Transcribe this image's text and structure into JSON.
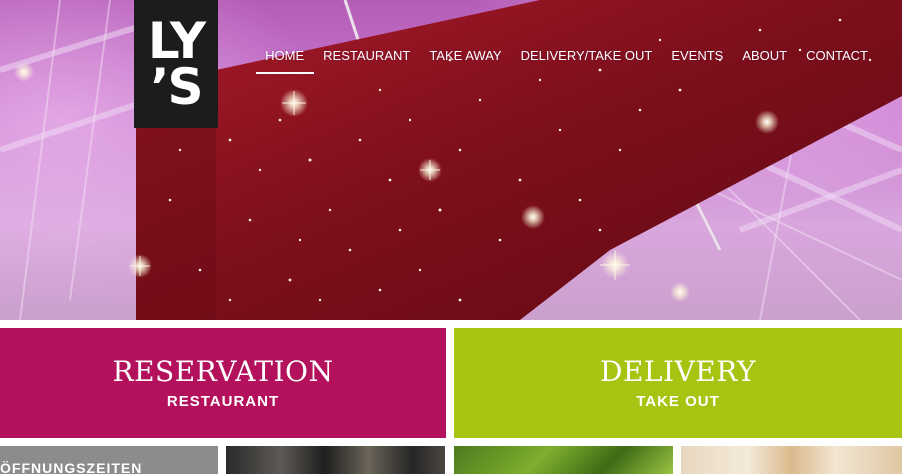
{
  "logo": {
    "line1": "LY",
    "line2": "’S"
  },
  "nav": {
    "items": [
      {
        "label": "HOME",
        "active": true
      },
      {
        "label": "RESTAURANT",
        "active": false
      },
      {
        "label": "TAKE AWAY",
        "active": false
      },
      {
        "label": "DELIVERY/TAKE OUT",
        "active": false
      },
      {
        "label": "EVENTS",
        "active": false
      },
      {
        "label": "ABOUT",
        "active": false
      },
      {
        "label": "CONTACT",
        "active": false
      }
    ]
  },
  "tiles": {
    "reservation": {
      "title": "RESERVATION",
      "subtitle": "RESTAURANT",
      "color": "#b3115c"
    },
    "delivery": {
      "title": "DELIVERY",
      "subtitle": "TAKE OUT",
      "color": "#a6c412"
    }
  },
  "strip": {
    "hours_label": "ÖFFNUNGSZEITEN"
  },
  "colors": {
    "hero_purple": "#c97bd0",
    "logo_bg": "#1e1b1d",
    "ceiling_red": "#8e1420"
  }
}
